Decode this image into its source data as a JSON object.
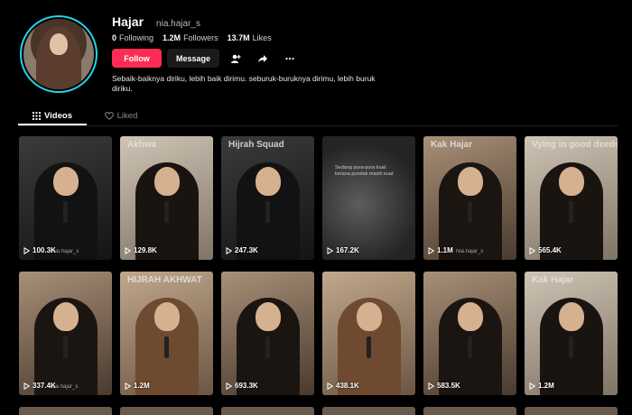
{
  "profile": {
    "display_name": "Hajar",
    "handle": "nia.hajar_s",
    "avatar_icon": "avatar-photo",
    "stats": {
      "following_value": "0",
      "following_label": "Following",
      "followers_value": "1.2M",
      "followers_label": "Followers",
      "likes_value": "13.7M",
      "likes_label": "Likes"
    },
    "actions": {
      "follow_label": "Follow",
      "message_label": "Message",
      "add_friend_icon": "add-friend-icon",
      "share_icon": "share-icon",
      "more_icon": "more-icon"
    },
    "bio": "Sebaik-baiknya diriku, lebih baik dirimu. seburuk-buruknya dirimu, lebih buruk diriku."
  },
  "tabs": [
    {
      "label": "Videos",
      "icon": "grid-icon",
      "active": true
    },
    {
      "label": "Liked",
      "icon": "heart-outline-icon",
      "active": false
    }
  ],
  "colors": {
    "accent": "#fe2c55",
    "ring": "#20d5ec",
    "background": "#000000"
  },
  "videos": [
    {
      "views": "100.3K",
      "overlay": "",
      "watermark": "Nia.hajar_s",
      "theme": "dark"
    },
    {
      "views": "129.8K",
      "overlay": "Akhwa",
      "watermark": "",
      "theme": "light"
    },
    {
      "views": "247.3K",
      "overlay": "Hijrah Squad",
      "watermark": "",
      "theme": "dark"
    },
    {
      "views": "167.2K",
      "overlay": "",
      "watermark": "",
      "theme": "fog",
      "caption": "Sedang pura-pura kuat kerana pundak masih kuat"
    },
    {
      "views": "1.1M",
      "overlay": "Kak Hajar",
      "watermark": "Nia.hajar_s",
      "theme": "warm"
    },
    {
      "views": "565.4K",
      "overlay": "Vying in good deeds",
      "watermark": "",
      "theme": "light"
    },
    {
      "views": "337.4K",
      "overlay": "",
      "watermark": "nia.hajar_s",
      "theme": "warm"
    },
    {
      "views": "1.2M",
      "overlay": "HIJRAH AKHWAT",
      "watermark": "",
      "theme": "brown"
    },
    {
      "views": "693.3K",
      "overlay": "",
      "watermark": "",
      "theme": "warm"
    },
    {
      "views": "438.1K",
      "overlay": "",
      "watermark": "",
      "theme": "brown"
    },
    {
      "views": "583.5K",
      "overlay": "",
      "watermark": "",
      "theme": "warm"
    },
    {
      "views": "1.2M",
      "overlay": "Kak Hajar",
      "watermark": "",
      "theme": "light"
    }
  ]
}
